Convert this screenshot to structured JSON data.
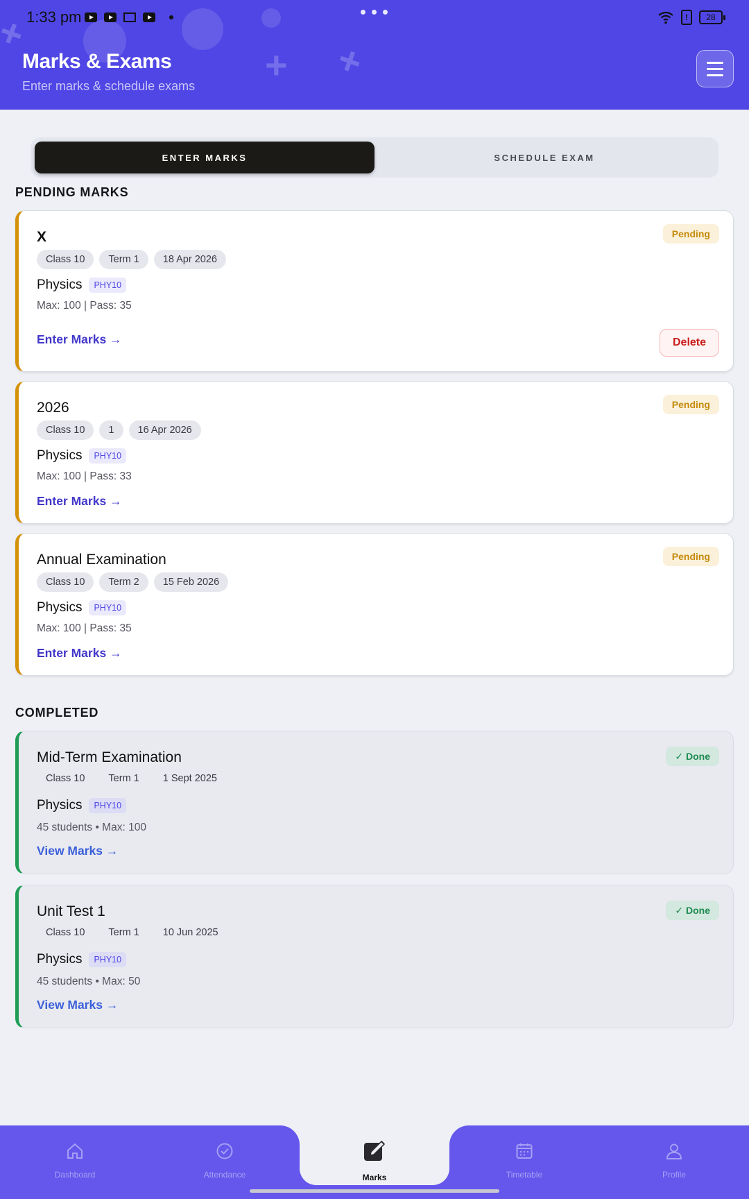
{
  "status_bar": {
    "time": "1:33 pm",
    "battery": "28"
  },
  "header": {
    "title": "Marks & Exams",
    "subtitle": "Enter marks & schedule exams"
  },
  "tabs": [
    {
      "label": "ENTER MARKS",
      "active": true
    },
    {
      "label": "SCHEDULE EXAM",
      "active": false
    }
  ],
  "sections": {
    "pending": "PENDING MARKS",
    "completed": "COMPLETED"
  },
  "pending": [
    {
      "title": "X",
      "status": "Pending",
      "chips": [
        "Class 10",
        "Term 1",
        "18 Apr 2026"
      ],
      "subject": "Physics",
      "code": "PHY10",
      "meta": "Max: 100 | Pass: 35",
      "action": "Enter Marks →",
      "delete": "Delete"
    },
    {
      "title": "2026",
      "status": "Pending",
      "chips": [
        "Class 10",
        "1",
        "16 Apr 2026"
      ],
      "subject": "Physics",
      "code": "PHY10",
      "meta": "Max: 100 | Pass: 33",
      "action": "Enter Marks →"
    },
    {
      "title": "Annual Examination",
      "status": "Pending",
      "chips": [
        "Class 10",
        "Term 2",
        "15 Feb 2026"
      ],
      "subject": "Physics",
      "code": "PHY10",
      "meta": "Max: 100 | Pass: 35",
      "action": "Enter Marks →"
    }
  ],
  "completed": [
    {
      "title": "Mid-Term Examination",
      "status": "✓ Done",
      "chips": [
        "Class 10",
        "Term 1",
        "1 Sept 2025"
      ],
      "subject": "Physics",
      "code": "PHY10",
      "meta": "45 students • Max: 100",
      "action": "View Marks →"
    },
    {
      "title": "Unit Test 1",
      "status": "✓ Done",
      "chips": [
        "Class 10",
        "Term 1",
        "10 Jun 2025"
      ],
      "subject": "Physics",
      "code": "PHY10",
      "meta": "45 students • Max: 50",
      "action": "View Marks →"
    }
  ],
  "nav": [
    {
      "label": "Dashboard",
      "icon": "home-icon"
    },
    {
      "label": "Attendance",
      "icon": "check-circle-icon"
    },
    {
      "label": "Marks",
      "icon": "edit-icon",
      "active": true
    },
    {
      "label": "Timetable",
      "icon": "calendar-icon"
    },
    {
      "label": "Profile",
      "icon": "user-icon"
    }
  ],
  "colors": {
    "header": "#4f46e5",
    "pending_accent": "#d4920b",
    "done_accent": "#1f9d55",
    "nav": "#6557ec",
    "delete": "#c81e1e"
  }
}
